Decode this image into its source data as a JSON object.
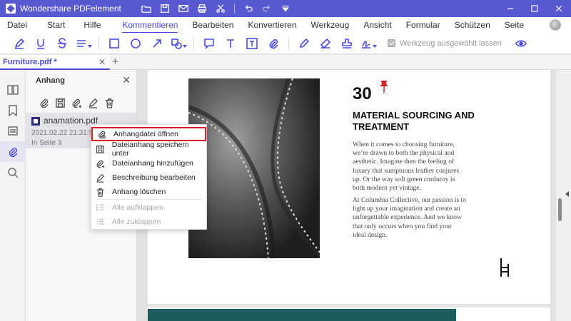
{
  "app": {
    "title": "Wondershare PDFelement"
  },
  "menu": {
    "items": [
      "Datei",
      "Start",
      "Hilfe",
      "Kommentieren",
      "Bearbeiten",
      "Konvertieren",
      "Werkzeug",
      "Ansicht",
      "Formular",
      "Schützen",
      "Seite"
    ],
    "active": "Kommentieren"
  },
  "toolbar": {
    "keep_tool_label": "Werkzeug ausgewählt lassen",
    "keep_tool_checked": true
  },
  "tab": {
    "label": "Furniture.pdf *",
    "new_tab": "+"
  },
  "panel": {
    "title": "Anhang",
    "attachment": {
      "name": "anamation.pdf",
      "date": "2021.02.22 21:31:50",
      "page": "In Seite 3"
    }
  },
  "context_menu": {
    "items": [
      {
        "label": "Anhangdatei öffnen",
        "icon": "paperclip-open-icon",
        "highlighted": true,
        "disabled": false
      },
      {
        "label": "Dateianhang speichern unter",
        "icon": "save-icon",
        "highlighted": false,
        "disabled": false
      },
      {
        "label": "Dateianhang hinzufügen",
        "icon": "paperclip-add-icon",
        "highlighted": false,
        "disabled": false
      },
      {
        "label": "Beschreibung bearbeiten",
        "icon": "pen-icon",
        "highlighted": false,
        "disabled": false
      },
      {
        "label": "Anhang löschen",
        "icon": "trash-icon",
        "highlighted": false,
        "disabled": false
      },
      {
        "label": "Alle aufklappen",
        "icon": "expand-list-icon",
        "highlighted": false,
        "disabled": true
      },
      {
        "label": "Alle zuklappen",
        "icon": "collapse-list-icon",
        "highlighted": false,
        "disabled": true
      }
    ]
  },
  "document": {
    "page_number": "30",
    "heading": "MATERIAL SOURCING AND TREATMENT",
    "para1": "When it comes to choosing furniture, we’re drawn to both the physical and aesthetic. Imagine then the feeling of luxury that sumptuous leather conjures up. Or the way soft green corduroy is both modern yet vintage.",
    "para2": "At Columbia Collective, our passion is to light up your imagination and create an unforgettable experience. And we know that only occurs when you find your ideal design."
  },
  "colors": {
    "titlebar": "#5858d1",
    "accent": "#4b4be0",
    "highlight_border": "#d71f2c",
    "teal_band": "#1d5b5c"
  }
}
